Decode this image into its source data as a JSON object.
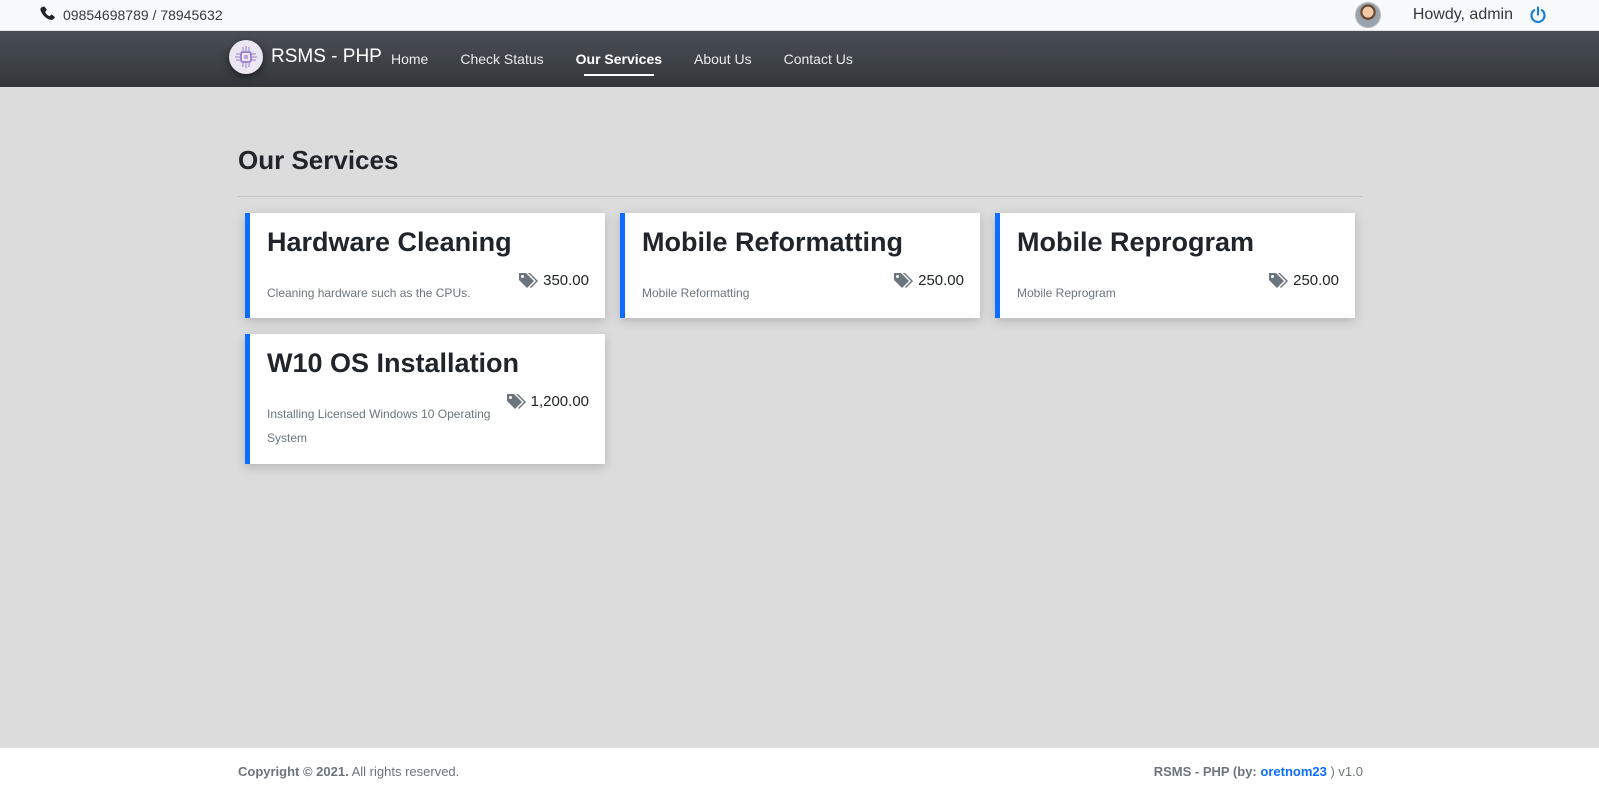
{
  "topbar": {
    "phone": "09854698789 / 78945632",
    "greeting": "Howdy, admin",
    "icons": {
      "phone": "phone-icon",
      "avatar": "user-avatar",
      "logout": "power-icon"
    }
  },
  "navbar": {
    "brand": "RSMS - PHP",
    "items": [
      {
        "label": "Home"
      },
      {
        "label": "Check Status"
      },
      {
        "label": "Our Services",
        "active": true
      },
      {
        "label": "About Us"
      },
      {
        "label": "Contact Us"
      }
    ]
  },
  "main": {
    "title": "Our Services",
    "services": [
      {
        "name": "Hardware Cleaning",
        "description": "Cleaning hardware such as the CPUs.",
        "price": "350.00"
      },
      {
        "name": "Mobile Reformatting",
        "description": "Mobile Reformatting",
        "price": "250.00"
      },
      {
        "name": "Mobile Reprogram",
        "description": "Mobile Reprogram",
        "price": "250.00"
      },
      {
        "name": "W10 OS Installation",
        "description": "Installing Licensed Windows 10 Operating System",
        "price": "1,200.00"
      }
    ]
  },
  "footer": {
    "copyright_bold": "Copyright © 2021.",
    "copyright_rest": "All rights reserved.",
    "app_by": "RSMS - PHP (by:",
    "author": "oretnom23",
    "version": ") v1.0"
  },
  "colors": {
    "accent": "#0d6efd",
    "navbar": "#3d4247",
    "background": "#dcdcdc"
  }
}
